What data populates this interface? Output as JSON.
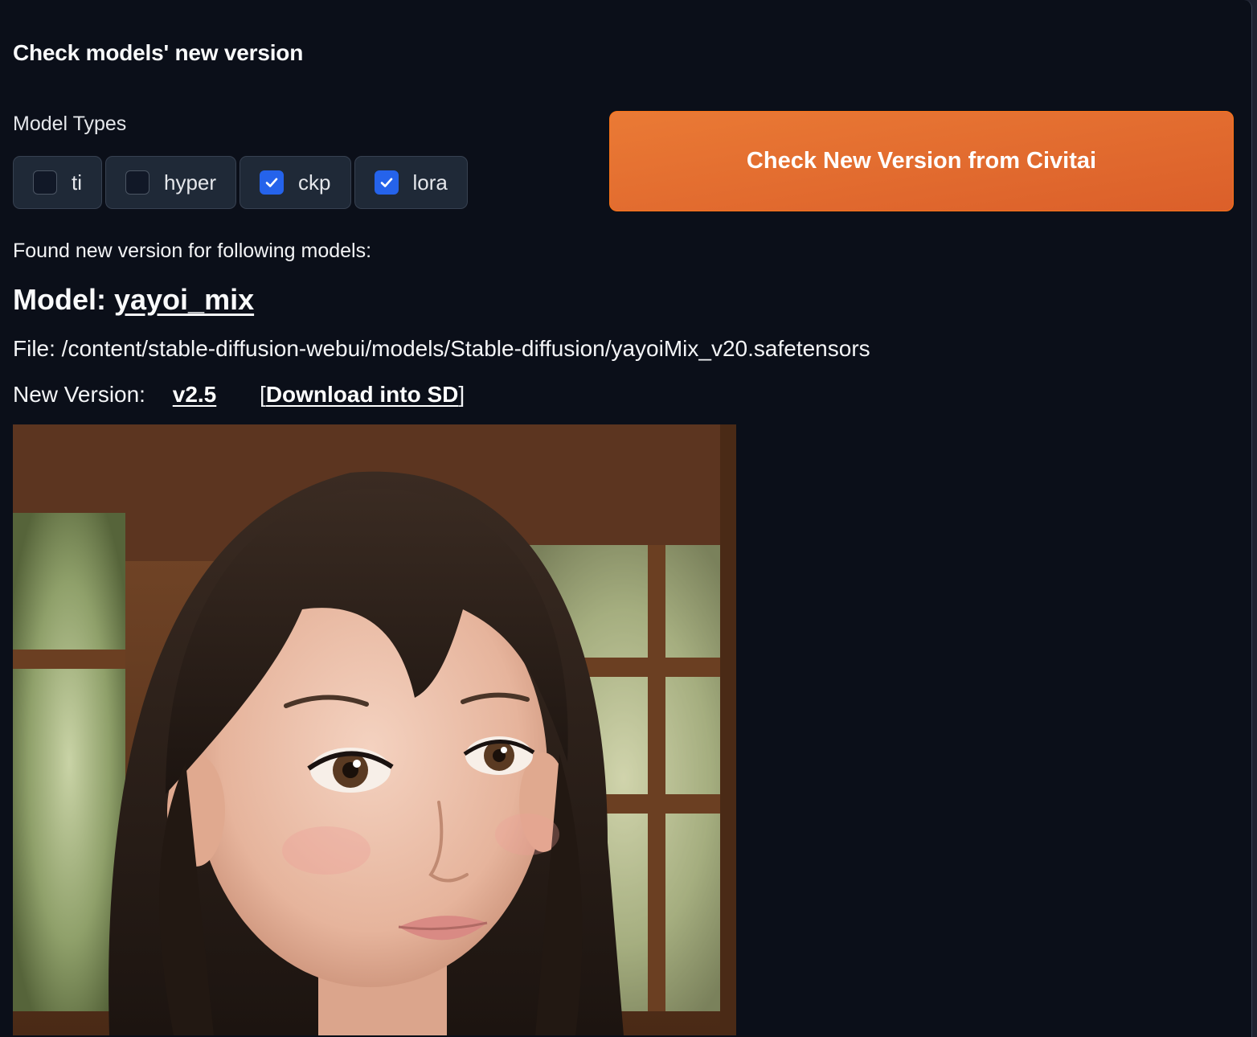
{
  "section": {
    "title": "Check models' new version"
  },
  "model_types": {
    "label": "Model Types",
    "options": [
      {
        "label": "ti",
        "checked": false
      },
      {
        "label": "hyper",
        "checked": false
      },
      {
        "label": "ckp",
        "checked": true
      },
      {
        "label": "lora",
        "checked": true
      }
    ]
  },
  "check_button": {
    "label": "Check New Version from Civitai"
  },
  "results": {
    "found_text": "Found new version for following models:",
    "model_prefix": "Model: ",
    "model_name": "yayoi_mix",
    "file_line": "File: /content/stable-diffusion-webui/models/Stable-diffusion/yayoiMix_v20.safetensors",
    "new_version_label": "New Version:",
    "version": "v2.5",
    "bracket_open": "[",
    "download_label": "Download into SD",
    "bracket_close": "]"
  },
  "colors": {
    "panel_bg": "#0b0f19",
    "accent_orange": "#e8722f",
    "checkbox_checked": "#2563eb"
  }
}
